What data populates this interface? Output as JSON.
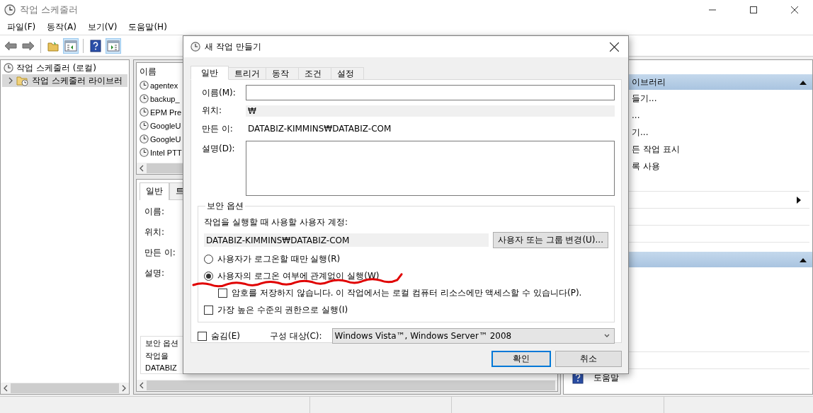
{
  "window": {
    "title": "작업 스케줄러"
  },
  "menu": [
    "파일(F)",
    "동작(A)",
    "보기(V)",
    "도움말(H)"
  ],
  "toolbar": [
    {
      "kind": "back",
      "pressed": false
    },
    {
      "kind": "forward",
      "pressed": false
    },
    {
      "kind": "separator"
    },
    {
      "kind": "folder",
      "pressed": false
    },
    {
      "kind": "panel-left",
      "pressed": true
    },
    {
      "kind": "separator"
    },
    {
      "kind": "help",
      "pressed": false
    },
    {
      "kind": "panel-right",
      "pressed": true
    }
  ],
  "tree": [
    {
      "label": "작업 스케줄러 (로컬)",
      "selected": false,
      "children": [
        {
          "label": "작업 스케줄러 라이브러",
          "selected": true,
          "expanded": false
        }
      ]
    }
  ],
  "task_list": {
    "column": "이름",
    "rows": [
      "agentex",
      "backup_",
      "EPM Pre",
      "GoogleU",
      "GoogleU",
      "Intel PTT"
    ]
  },
  "details": {
    "tabs": [
      {
        "label": "일반",
        "selected": true
      },
      {
        "label": "트",
        "selected": false
      }
    ],
    "labels": [
      "이름:",
      "위치:",
      "만든 이:",
      "설명:"
    ],
    "group": "보안 옵션",
    "group_text": "작업을",
    "account": "DATABIZ"
  },
  "actions": [
    {
      "title": "이브러리",
      "expanded": true,
      "items": [
        {
          "kind": "text",
          "label": "들기..."
        },
        {
          "kind": "text",
          "label": "..."
        },
        {
          "kind": "text",
          "label": "기..."
        },
        {
          "kind": "text",
          "label": "든 작업 표시"
        },
        {
          "kind": "text",
          "label": "록 사용"
        },
        {
          "kind": "blank"
        },
        {
          "kind": "submenu"
        },
        {
          "kind": "blank"
        },
        {
          "kind": "blank"
        }
      ]
    },
    {
      "expanded": true,
      "items": [
        {
          "kind": "space"
        },
        {
          "kind": "space"
        },
        {
          "kind": "space"
        },
        {
          "kind": "space"
        },
        {
          "kind": "blank"
        },
        {
          "kind": "blank"
        },
        {
          "kind": "help",
          "label": "도움말"
        }
      ]
    }
  ],
  "dialog": {
    "title": "새 작업 만들기",
    "tabs": [
      {
        "label": "일반",
        "selected": true
      },
      {
        "label": "트리거",
        "selected": false
      },
      {
        "label": "동작",
        "selected": false
      },
      {
        "label": "조건",
        "selected": false
      },
      {
        "label": "설정",
        "selected": false
      }
    ],
    "name_label": "이름(M):",
    "location_label": "위치:",
    "location": "₩",
    "author_label": "만든 이:",
    "author": "DATABIZ-KIMMINS₩DATABIZ-COM",
    "description_label": "설명(D):",
    "security": {
      "title": "보안 옵션",
      "account_label": "작업을 실행할 때 사용할 사용자 계정:",
      "account": "DATABIZ-KIMMINS₩DATABIZ-COM",
      "change_button": "사용자 또는 그룹 변경(U)...",
      "options": [
        {
          "kind": "radio",
          "label": "사용자가 로그온할 때만 실행(R)",
          "selected": false,
          "indented": false
        },
        {
          "kind": "radio",
          "label": "사용자의 로그온 여부에 관계없이 실행(W)",
          "selected": true,
          "indented": false
        },
        {
          "kind": "checkbox",
          "label": "암호를 저장하지 않습니다. 이 작업에서는 로컬 컴퓨터 리소스에만 액세스할 수 있습니다(P).",
          "checked": false,
          "indented": true
        },
        {
          "kind": "checkbox",
          "label": "가장 높은 수준의 권한으로 실행(I)",
          "checked": false,
          "indented": false
        }
      ]
    },
    "hidden": {
      "label": "숨김(E)",
      "checked": false
    },
    "configure_label": "구성 대상(C):",
    "configure_value": "Windows Vista™, Windows Server™ 2008",
    "buttons": [
      {
        "label": "확인",
        "default": true
      },
      {
        "label": "취소",
        "default": false
      }
    ]
  }
}
